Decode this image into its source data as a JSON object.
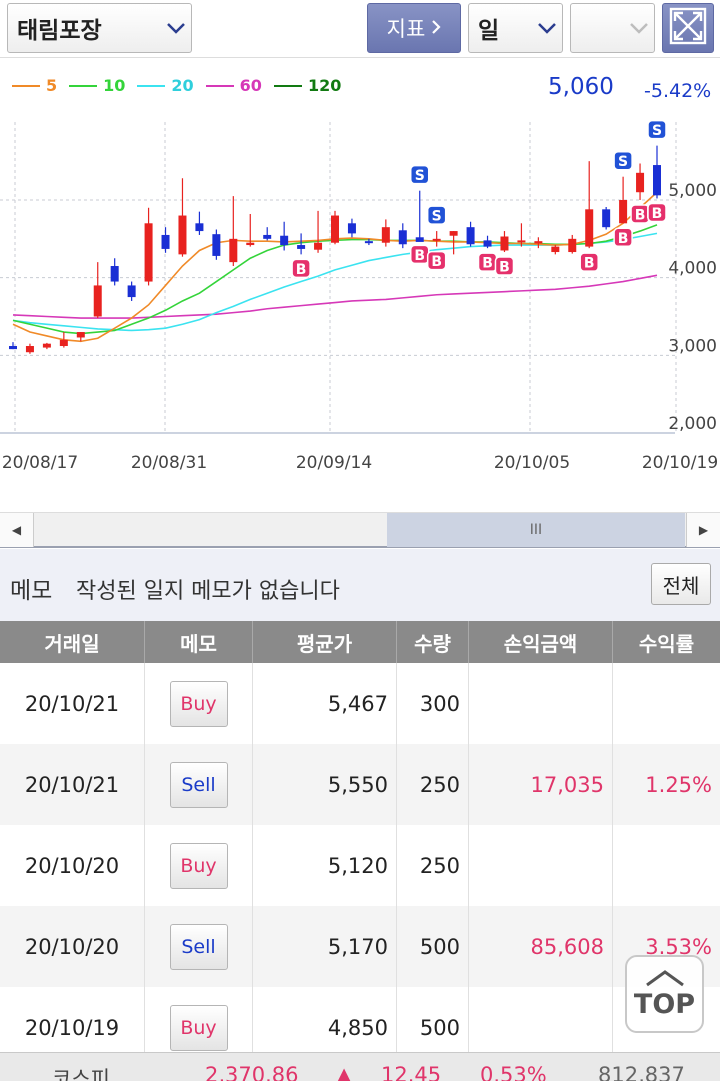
{
  "toolbar": {
    "stock_name": "태림포장",
    "indicator_label": "지표",
    "period": "일",
    "blank_select": ""
  },
  "legend": [
    {
      "label": "5",
      "color": "#f08a28"
    },
    {
      "label": "10",
      "color": "#34d43a"
    },
    {
      "label": "20",
      "color": "#3be3f0"
    },
    {
      "label": "60",
      "color": "#d638b8"
    },
    {
      "label": "120",
      "color": "#127a12"
    }
  ],
  "price": {
    "current": "5,060",
    "change_pct": "-5.42%"
  },
  "chart_data": {
    "type": "candlestick",
    "y_ticks": [
      "5,000",
      "4,000",
      "3,000",
      "2,000"
    ],
    "x_ticks": [
      "20/08/17",
      "20/08/31",
      "20/09/14",
      "20/10/05",
      "20/10/19"
    ],
    "ylim": [
      2000,
      5800
    ],
    "grid": true,
    "candles": [
      {
        "o": 3120,
        "h": 3170,
        "l": 3080,
        "c": 3080
      },
      {
        "o": 3040,
        "h": 3150,
        "l": 3020,
        "c": 3120
      },
      {
        "o": 3100,
        "h": 3160,
        "l": 3080,
        "c": 3150
      },
      {
        "o": 3120,
        "h": 3300,
        "l": 3100,
        "c": 3200
      },
      {
        "o": 3230,
        "h": 3300,
        "l": 3180,
        "c": 3300
      },
      {
        "o": 3500,
        "h": 4200,
        "l": 3480,
        "c": 3900
      },
      {
        "o": 4150,
        "h": 4250,
        "l": 3900,
        "c": 3950
      },
      {
        "o": 3900,
        "h": 3950,
        "l": 3700,
        "c": 3750
      },
      {
        "o": 3950,
        "h": 4900,
        "l": 3900,
        "c": 4700
      },
      {
        "o": 4550,
        "h": 4650,
        "l": 4320,
        "c": 4370
      },
      {
        "o": 4300,
        "h": 5280,
        "l": 4270,
        "c": 4800
      },
      {
        "o": 4700,
        "h": 4850,
        "l": 4550,
        "c": 4600
      },
      {
        "o": 4560,
        "h": 4620,
        "l": 4230,
        "c": 4280
      },
      {
        "o": 4200,
        "h": 5050,
        "l": 4150,
        "c": 4500
      },
      {
        "o": 4420,
        "h": 4820,
        "l": 4400,
        "c": 4450
      },
      {
        "o": 4550,
        "h": 4650,
        "l": 4480,
        "c": 4500
      },
      {
        "o": 4540,
        "h": 4720,
        "l": 4350,
        "c": 4420
      },
      {
        "o": 4420,
        "h": 4570,
        "l": 4300,
        "c": 4370
      },
      {
        "o": 4360,
        "h": 4860,
        "l": 4320,
        "c": 4450
      },
      {
        "o": 4450,
        "h": 4860,
        "l": 4430,
        "c": 4800
      },
      {
        "o": 4700,
        "h": 4760,
        "l": 4520,
        "c": 4570
      },
      {
        "o": 4470,
        "h": 4500,
        "l": 4420,
        "c": 4450
      },
      {
        "o": 4450,
        "h": 4750,
        "l": 4400,
        "c": 4650
      },
      {
        "o": 4610,
        "h": 4700,
        "l": 4380,
        "c": 4430
      },
      {
        "o": 4520,
        "h": 5120,
        "l": 4480,
        "c": 4460
      },
      {
        "o": 4480,
        "h": 4600,
        "l": 4400,
        "c": 4500
      },
      {
        "o": 4540,
        "h": 4600,
        "l": 4300,
        "c": 4600
      },
      {
        "o": 4650,
        "h": 4720,
        "l": 4400,
        "c": 4430
      },
      {
        "o": 4480,
        "h": 4540,
        "l": 4380,
        "c": 4400
      },
      {
        "o": 4350,
        "h": 4600,
        "l": 4330,
        "c": 4530
      },
      {
        "o": 4460,
        "h": 4700,
        "l": 4400,
        "c": 4480
      },
      {
        "o": 4440,
        "h": 4520,
        "l": 4380,
        "c": 4470
      },
      {
        "o": 4330,
        "h": 4420,
        "l": 4300,
        "c": 4400
      },
      {
        "o": 4330,
        "h": 4550,
        "l": 4310,
        "c": 4500
      },
      {
        "o": 4400,
        "h": 5500,
        "l": 4380,
        "c": 4880
      },
      {
        "o": 4880,
        "h": 4910,
        "l": 4620,
        "c": 4650
      },
      {
        "o": 4700,
        "h": 5300,
        "l": 4700,
        "c": 5000
      },
      {
        "o": 5100,
        "h": 5470,
        "l": 5000,
        "c": 5350
      },
      {
        "o": 5450,
        "h": 5700,
        "l": 5020,
        "c": 5060
      }
    ],
    "ma5": [
      3400,
      3300,
      3250,
      3200,
      3180,
      3220,
      3350,
      3480,
      3650,
      3900,
      4150,
      4350,
      4450,
      4480,
      4470,
      4470,
      4460,
      4470,
      4480,
      4500,
      4510,
      4500,
      4480,
      4470,
      4480,
      4470,
      4460,
      4460,
      4450,
      4440,
      4440,
      4430,
      4420,
      4430,
      4480,
      4560,
      4700,
      4900,
      5100
    ],
    "ma10": [
      3450,
      3400,
      3350,
      3300,
      3280,
      3300,
      3320,
      3400,
      3480,
      3580,
      3700,
      3800,
      3950,
      4100,
      4250,
      4350,
      4420,
      4450,
      4470,
      4480,
      4490,
      4490,
      4480,
      4480,
      4480,
      4470,
      4470,
      4460,
      4460,
      4450,
      4440,
      4440,
      4430,
      4430,
      4440,
      4470,
      4530,
      4600,
      4680
    ],
    "ma20": [
      3450,
      3420,
      3400,
      3380,
      3360,
      3340,
      3330,
      3320,
      3330,
      3350,
      3400,
      3460,
      3550,
      3630,
      3720,
      3800,
      3880,
      3950,
      4020,
      4100,
      4160,
      4220,
      4260,
      4300,
      4330,
      4360,
      4380,
      4400,
      4410,
      4420,
      4420,
      4420,
      4420,
      4430,
      4440,
      4460,
      4490,
      4530,
      4570
    ],
    "ma60": [
      3520,
      3510,
      3500,
      3490,
      3480,
      3480,
      3480,
      3480,
      3490,
      3500,
      3510,
      3520,
      3530,
      3550,
      3570,
      3600,
      3620,
      3640,
      3660,
      3680,
      3700,
      3710,
      3720,
      3740,
      3760,
      3780,
      3790,
      3800,
      3810,
      3820,
      3830,
      3840,
      3850,
      3870,
      3890,
      3920,
      3950,
      3990,
      4030
    ]
  },
  "trade_markers": [
    {
      "type": "B",
      "idx": 17
    },
    {
      "type": "S",
      "idx": 24
    },
    {
      "type": "B",
      "idx": 24
    },
    {
      "type": "B",
      "idx": 25
    },
    {
      "type": "S",
      "idx": 25
    },
    {
      "type": "B",
      "idx": 28
    },
    {
      "type": "B",
      "idx": 29
    },
    {
      "type": "B",
      "idx": 34
    },
    {
      "type": "S",
      "idx": 36
    },
    {
      "type": "B",
      "idx": 36
    },
    {
      "type": "B",
      "idx": 37
    },
    {
      "type": "S",
      "idx": 38
    },
    {
      "type": "B",
      "idx": 38
    },
    {
      "type": "B",
      "idx": 39
    },
    {
      "type": "S",
      "idx": 39
    },
    {
      "type": "B",
      "idx": 40
    },
    {
      "type": "S",
      "idx": 40
    },
    {
      "type": "S",
      "idx": 41
    },
    {
      "type": "B",
      "idx": 41
    }
  ],
  "memo": {
    "title": "메모",
    "message": "작성된 일지 메모가 없습니다",
    "all_button": "전체"
  },
  "table": {
    "headers": [
      "거래일",
      "메모",
      "평균가",
      "수량",
      "손익금액",
      "수익률"
    ],
    "rows": [
      {
        "date": "20/10/21",
        "memo": "Buy",
        "avg": "5,467",
        "qty": "300",
        "pl": "",
        "ret": ""
      },
      {
        "date": "20/10/21",
        "memo": "Sell",
        "avg": "5,550",
        "qty": "250",
        "pl": "17,035",
        "ret": "1.25%"
      },
      {
        "date": "20/10/20",
        "memo": "Buy",
        "avg": "5,120",
        "qty": "250",
        "pl": "",
        "ret": ""
      },
      {
        "date": "20/10/20",
        "memo": "Sell",
        "avg": "5,170",
        "qty": "500",
        "pl": "85,608",
        "ret": "3.53%"
      },
      {
        "date": "20/10/19",
        "memo": "Buy",
        "avg": "4,850",
        "qty": "500",
        "pl": "",
        "ret": ""
      }
    ]
  },
  "top_button": "TOP",
  "scroll": {
    "thumb_label": "III"
  },
  "ticker": {
    "name": "코스피",
    "value": "2,370.86",
    "arrow": "▲",
    "change": "12.45",
    "pct": "0.53%",
    "volume": "812,837"
  }
}
